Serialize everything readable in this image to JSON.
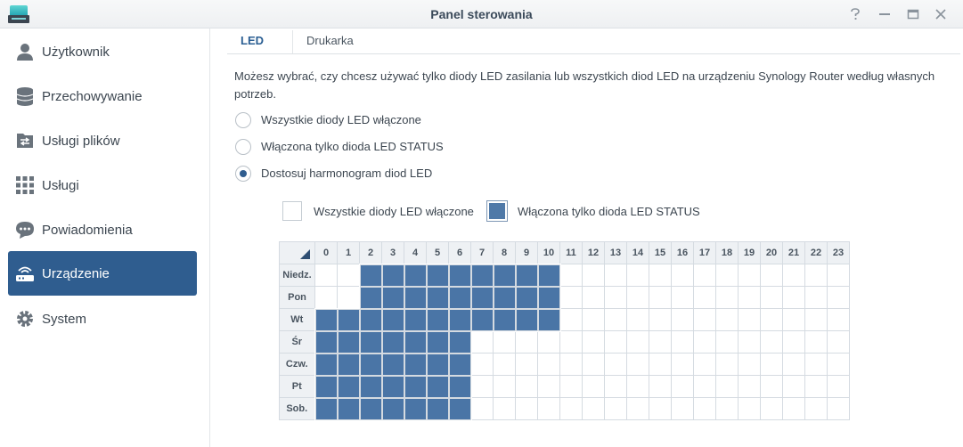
{
  "window": {
    "title": "Panel sterowania",
    "controls": [
      "?",
      "–",
      "□",
      "✕"
    ]
  },
  "sidebar": {
    "items": [
      {
        "label": "Użytkownik",
        "icon": "user-icon"
      },
      {
        "label": "Przechowywanie",
        "icon": "storage-icon"
      },
      {
        "label": "Usługi plików",
        "icon": "file-services-icon"
      },
      {
        "label": "Usługi",
        "icon": "services-grid-icon"
      },
      {
        "label": "Powiadomienia",
        "icon": "chat-bubble-icon"
      },
      {
        "label": "Urządzenie",
        "icon": "router-icon",
        "active": true
      },
      {
        "label": "System",
        "icon": "gear-icon"
      }
    ]
  },
  "tabs": [
    {
      "label": "LED",
      "active": true
    },
    {
      "label": "Drukarka"
    }
  ],
  "description": "Możesz wybrać, czy chcesz używać tylko diody LED zasilania lub wszystkich diod LED na urządzeniu Synology Router według własnych potrzeb.",
  "options": [
    {
      "label": "Wszystkie diody LED włączone",
      "checked": false
    },
    {
      "label": "Włączona tylko dioda LED STATUS",
      "checked": false
    },
    {
      "label": "Dostosuj harmonogram diod LED",
      "checked": true
    }
  ],
  "legend": {
    "all_on": "Wszystkie diody LED włączone",
    "status_only": "Włączona tylko dioda LED STATUS"
  },
  "schedule": {
    "hours": [
      "0",
      "1",
      "2",
      "3",
      "4",
      "5",
      "6",
      "7",
      "8",
      "9",
      "10",
      "11",
      "12",
      "13",
      "14",
      "15",
      "16",
      "17",
      "18",
      "19",
      "20",
      "21",
      "22",
      "23"
    ],
    "days": [
      {
        "label": "Niedz.",
        "on": [
          2,
          3,
          4,
          5,
          6,
          7,
          8,
          9,
          10
        ]
      },
      {
        "label": "Pon",
        "on": [
          2,
          3,
          4,
          5,
          6,
          7,
          8,
          9,
          10
        ]
      },
      {
        "label": "Wt",
        "on": [
          0,
          1,
          2,
          3,
          4,
          5,
          6,
          7,
          8,
          9,
          10
        ]
      },
      {
        "label": "Śr",
        "on": [
          0,
          1,
          2,
          3,
          4,
          5,
          6
        ]
      },
      {
        "label": "Czw.",
        "on": [
          0,
          1,
          2,
          3,
          4,
          5,
          6
        ]
      },
      {
        "label": "Pt",
        "on": [
          0,
          1,
          2,
          3,
          4,
          5,
          6
        ]
      },
      {
        "label": "Sob.",
        "on": [
          0,
          1,
          2,
          3,
          4,
          5,
          6
        ]
      }
    ]
  },
  "colors": {
    "accent": "#2f5d8f",
    "cell_on": "#4a75a6"
  }
}
